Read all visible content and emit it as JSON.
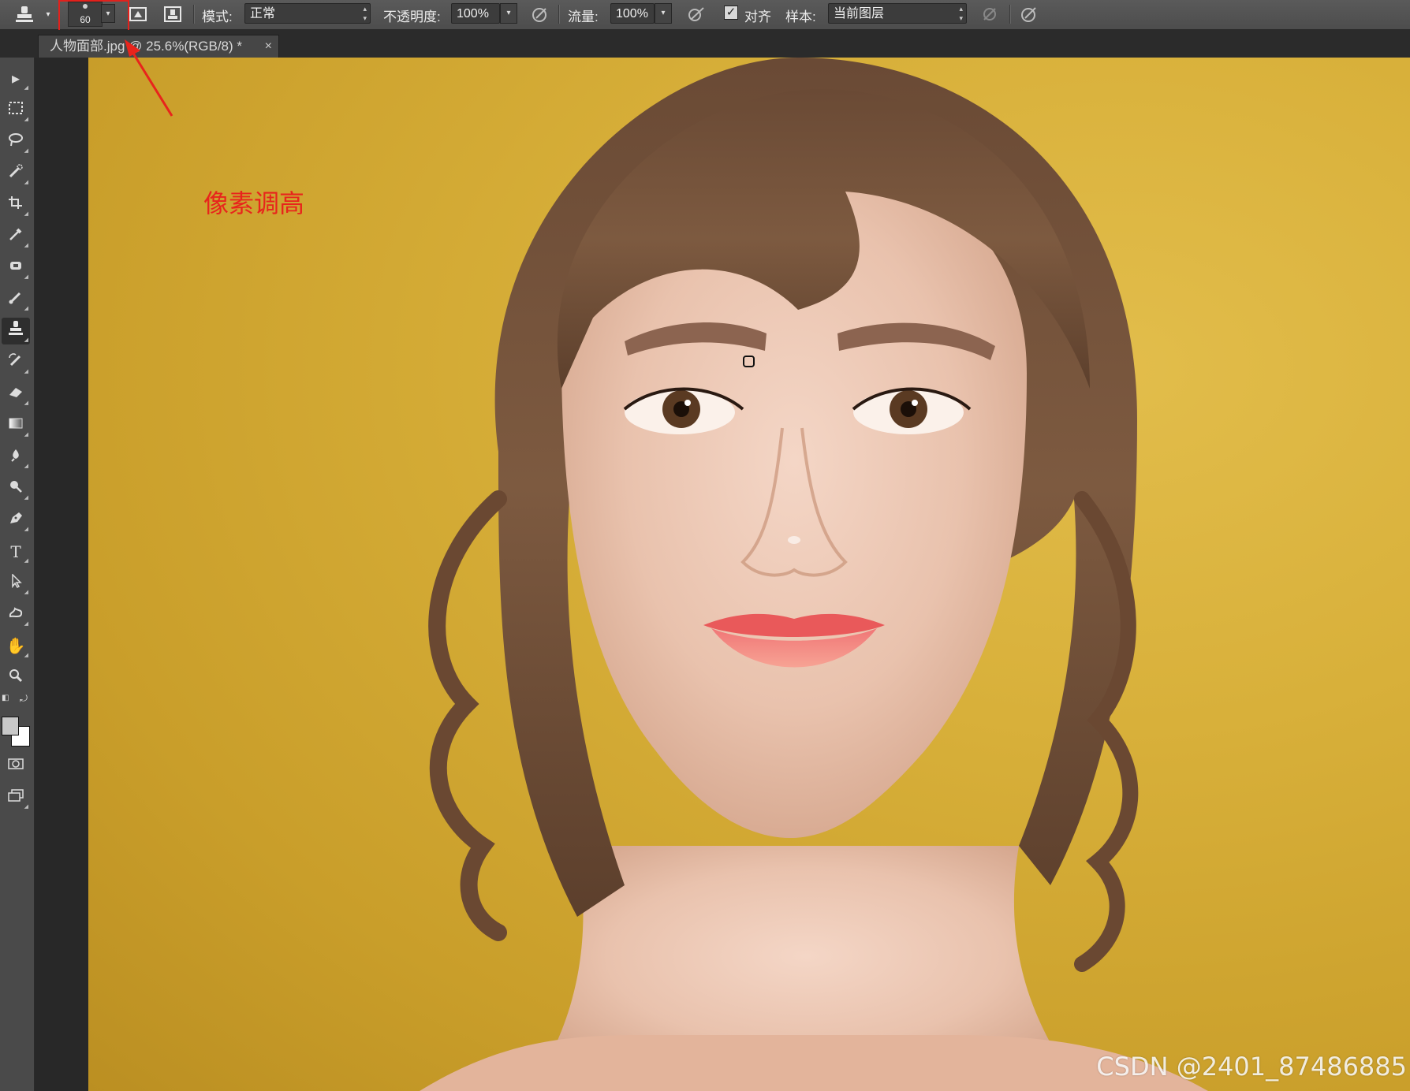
{
  "options_bar": {
    "tool_icon": "clone-stamp-icon",
    "brush_size": "60",
    "mode_label": "模式:",
    "mode_value": "正常",
    "opacity_label": "不透明度:",
    "opacity_value": "100%",
    "flow_label": "流量:",
    "flow_value": "100%",
    "aligned_label": "对齐",
    "aligned_checked": true,
    "sample_label": "样本:",
    "sample_value": "当前图层"
  },
  "document_tab": {
    "title": "人物面部.jpg @ 25.6%(RGB/8) *",
    "close": "×"
  },
  "tools": [
    "move-tool-icon",
    "marquee-tool-icon",
    "lasso-tool-icon",
    "quick-selection-tool-icon",
    "crop-tool-icon",
    "eyedropper-tool-icon",
    "spot-healing-tool-icon",
    "brush-tool-icon",
    "clone-stamp-tool-icon",
    "history-brush-tool-icon",
    "eraser-tool-icon",
    "gradient-tool-icon",
    "blur-tool-icon",
    "dodge-tool-icon",
    "pen-tool-icon",
    "type-tool-icon",
    "path-selection-tool-icon",
    "custom-shape-tool-icon",
    "hand-tool-icon",
    "zoom-tool-icon"
  ],
  "colors": {
    "foreground": "#c8c8c8",
    "background": "#ffffff",
    "annotation": "#e8241c",
    "canvas_background": "#d8b03a"
  },
  "annotation": {
    "text": "像素调高"
  },
  "watermark": {
    "text": "CSDN @2401_87486885"
  }
}
